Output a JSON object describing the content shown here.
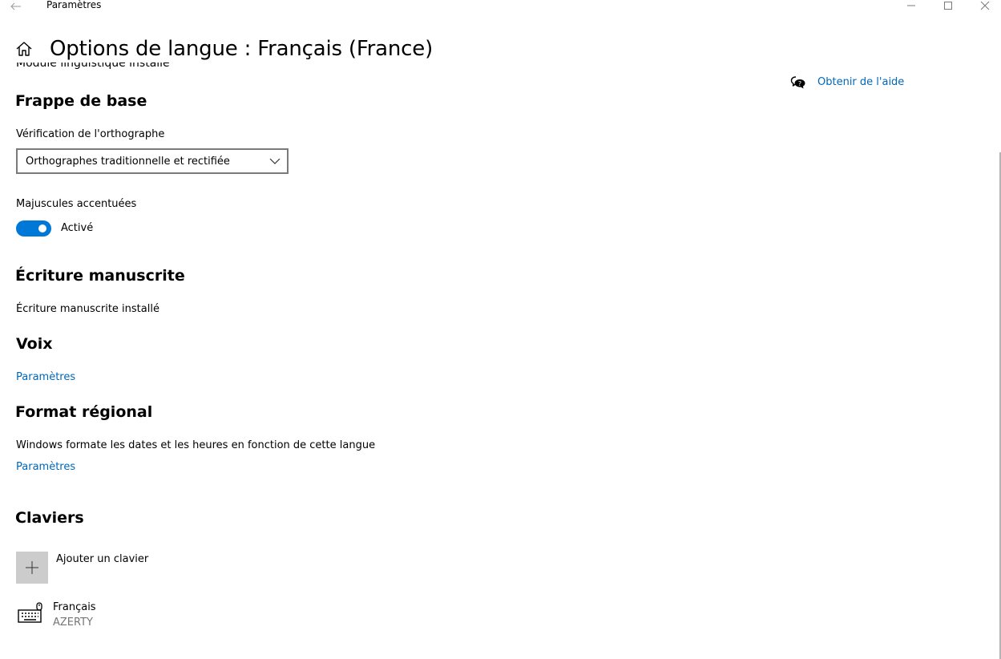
{
  "window": {
    "title": "Paramètres",
    "icons": {
      "back": "back-arrow-icon",
      "minimize": "minimize-icon",
      "maximize": "maximize-icon",
      "close": "close-icon"
    }
  },
  "header": {
    "home_icon": "home-icon",
    "title": "Options de langue : Français (France)"
  },
  "content": {
    "clipped_previous_line": "Module linguistique installé",
    "basic_typing": {
      "title": "Frappe de base",
      "spellcheck_label": "Vérification de l'orthographe",
      "spellcheck_value": "Orthographes traditionnelle et rectifiée",
      "accented_caps_label": "Majuscules accentuées",
      "accented_caps_state": "Activé",
      "accented_caps_on": true
    },
    "handwriting": {
      "title": "Écriture manuscrite",
      "status": "Écriture manuscrite installé"
    },
    "speech": {
      "title": "Voix",
      "settings_link": "Paramètres"
    },
    "regional_format": {
      "title": "Format régional",
      "description": "Windows formate les dates et les heures en fonction de cette langue",
      "settings_link": "Paramètres"
    },
    "keyboards": {
      "title": "Claviers",
      "add_label": "Ajouter un clavier",
      "add_icon": "plus-icon",
      "items": [
        {
          "name": "Français",
          "layout": "AZERTY",
          "icon": "keyboard-icon"
        }
      ]
    }
  },
  "help": {
    "icon": "help-chat-icon",
    "link": "Obtenir de l'aide"
  },
  "colors": {
    "accent": "#0078d7",
    "link": "#0067b8",
    "secondary_text": "#767676",
    "tile_bg": "#cccccc"
  }
}
